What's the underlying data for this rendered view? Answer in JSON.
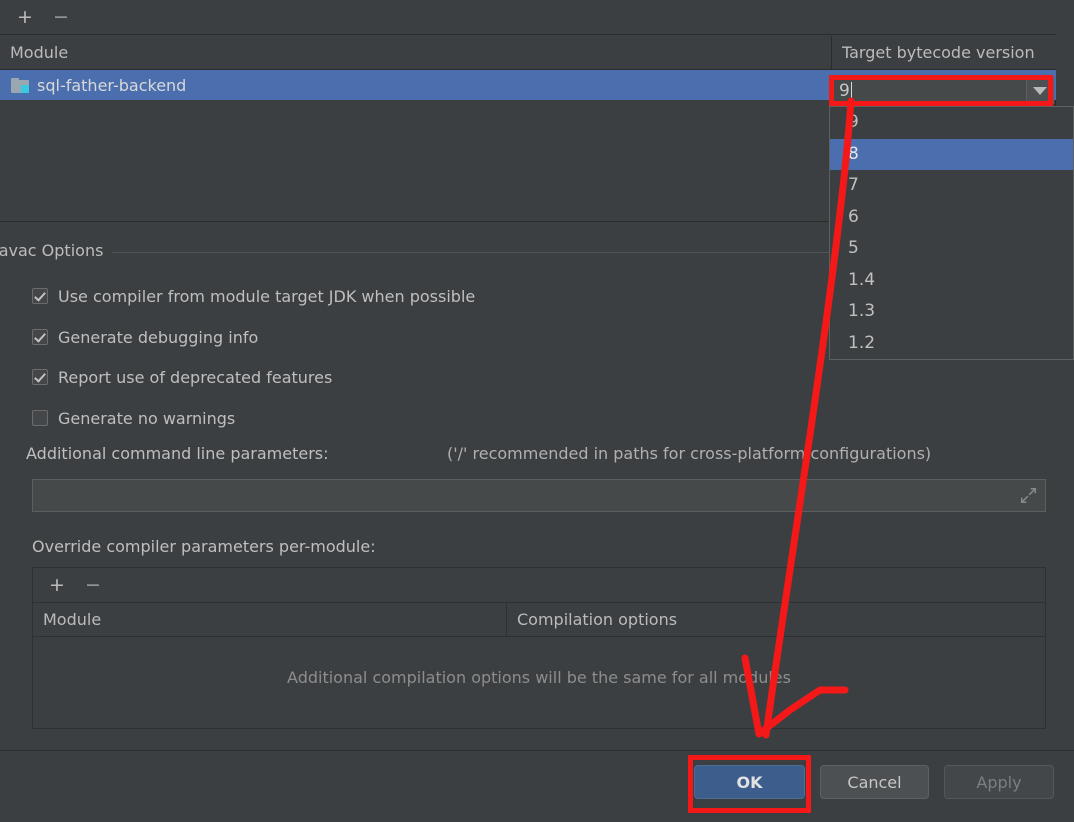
{
  "module_table": {
    "toolbar": {
      "add_label": "+",
      "remove_label": "−"
    },
    "columns": [
      "Module",
      "Target bytecode version"
    ],
    "rows": [
      {
        "icon": "module-folder-icon",
        "module": "sql-father-backend",
        "target_bytecode_version": "9"
      }
    ],
    "selected_row_index": 0
  },
  "bytecode_combo": {
    "value": "9",
    "arrow_icon": "chevron-down-icon",
    "expanded": true,
    "options": [
      "9",
      "8",
      "7",
      "6",
      "5",
      "1.4",
      "1.3",
      "1.2"
    ],
    "highlighted_option": "8"
  },
  "javac_options": {
    "group_title": "Javac Options",
    "checkboxes": [
      {
        "label": "Use compiler from module target JDK when possible",
        "checked": true
      },
      {
        "label": "Generate debugging info",
        "checked": true
      },
      {
        "label": "Report use of deprecated features",
        "checked": true
      },
      {
        "label": "Generate no warnings",
        "checked": false
      }
    ],
    "additional_params_label": "Additional command line parameters:",
    "additional_params_hint": "('/' recommended in paths for cross-platform configurations)",
    "additional_params_value": "",
    "expand_icon": "expand-arrows-icon"
  },
  "override_section": {
    "label": "Override compiler parameters per-module:",
    "toolbar": {
      "add_label": "+",
      "remove_label": "−"
    },
    "columns": [
      "Module",
      "Compilation options"
    ],
    "empty_message": "Additional compilation options will be the same for all modules",
    "rows": []
  },
  "footer": {
    "ok_label": "OK",
    "cancel_label": "Cancel",
    "apply_label": "Apply",
    "apply_enabled": false
  },
  "annotations": {
    "highlight_color": "#f41818",
    "boxes": [
      "bytecode-combo-editor",
      "ok-button"
    ],
    "arrow": "from bytecode combo editor down to OK button"
  }
}
